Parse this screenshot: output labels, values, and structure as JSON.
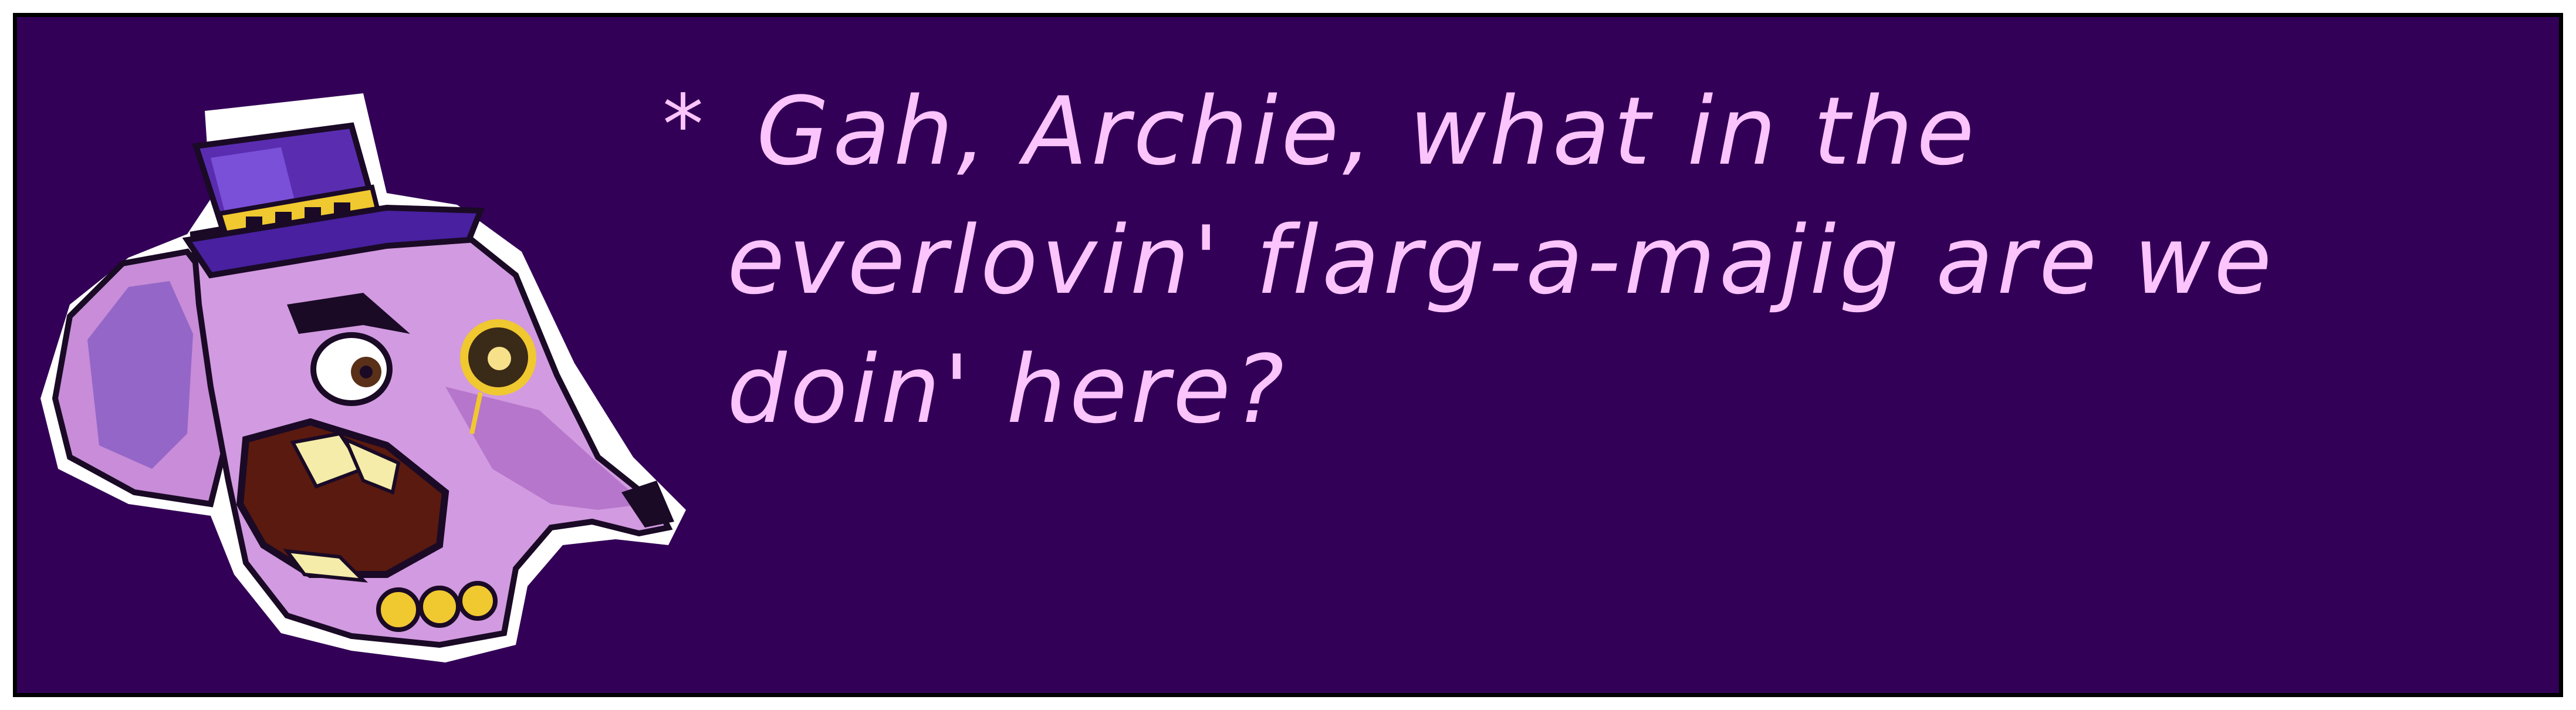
{
  "dialogue": {
    "speaker_portrait_icon": "elephant-in-top-hat-with-monocle-portrait-icon",
    "bullet": "*",
    "lines": [
      "Gah, Archie, what in the",
      "everlovin' flarg-a-majig are we",
      "doin' here?"
    ]
  },
  "colors": {
    "background": "#330057",
    "border": "#000000",
    "text": "#fcc4fc",
    "elephant_skin": "#c88cd8",
    "hat": "#5a2db0",
    "gold": "#f0c830"
  }
}
